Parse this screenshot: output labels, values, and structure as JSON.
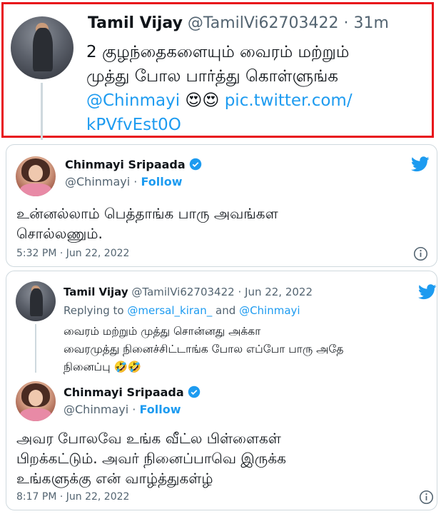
{
  "tweet1": {
    "author_name": "Tamil Vijay",
    "handle": "@TamilVi62703422",
    "separator": "·",
    "time": "31m",
    "text_line1": "2 குழந்தைகளையும் வைரம் மற்றும்",
    "text_line2": "முத்து போல பார்த்து கொள்ளுங்க",
    "mention": "@Chinmayi",
    "emoji": "😍😍",
    "link_part1": "pic.twitter.com/",
    "link_part2": "kPVfvEst0O",
    "highlight_color": "#e8111a"
  },
  "tweet2": {
    "author_name": "Chinmayi Sripaada",
    "handle": "@Chinmayi",
    "dot": "·",
    "follow_label": "Follow",
    "text_line1": "உன்னல்லாம் பெத்தாங்க பாரு அவங்கள",
    "text_line2": "சொல்லணும்.",
    "timestamp": "5:32 PM · Jun 22, 2022",
    "info_icon": "info-icon"
  },
  "tweet3": {
    "author_name": "Tamil Vijay",
    "handle": "@TamilVi62703422",
    "separator": "·",
    "date": "Jun 22, 2022",
    "replying_prefix": "Replying to",
    "reply_to_1": "@mersal_kiran_",
    "reply_and": "and",
    "reply_to_2": "@Chinmayi",
    "text_line1": "வைரம் மற்றும் முத்து சொன்னது அக்கா",
    "text_line2": "வைரமுத்து நினைச்சிட்டாங்க போல எப்போ பாரு அதே",
    "text_line3": "நினைப்பு",
    "emoji": "🤣🤣"
  },
  "tweet4": {
    "author_name": "Chinmayi Sripaada",
    "handle": "@Chinmayi",
    "dot": "·",
    "follow_label": "Follow",
    "text_line1": "அவர போலவே உங்க வீட்ல பிள்ளைகள்",
    "text_line2": "பிறக்கட்டும். அவர் நினைப்பாவெ இருக்க",
    "text_line3": "உங்களுக்கு என் வாழ்த்துகள்ழ்",
    "timestamp": "8:17 PM · Jun 22, 2022",
    "info_icon": "info-icon"
  },
  "colors": {
    "accent": "#1d9bf0",
    "secondary_text": "#536471",
    "border": "#cfd9de"
  }
}
